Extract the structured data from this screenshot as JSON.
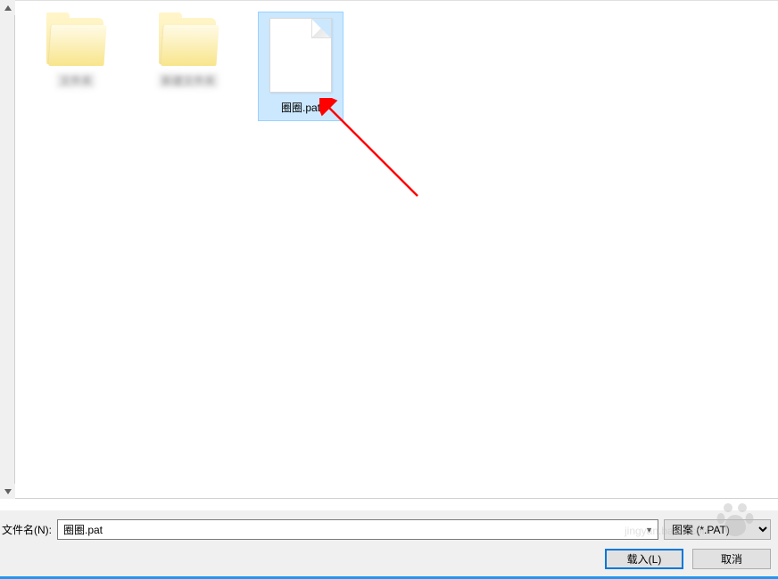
{
  "files": {
    "folder1": {
      "label": "文件夹"
    },
    "folder2": {
      "label": "新建文件夹"
    },
    "pat": {
      "label": "圈圈.pat"
    }
  },
  "bottom": {
    "filename_label": "文件名(N):",
    "filename_value": "圈圈.pat",
    "filetype_value": "图案 (*.PAT)",
    "load_button": "载入(L)",
    "cancel_button": "取消"
  },
  "watermark": {
    "text": "jingyan.baidu.com"
  }
}
